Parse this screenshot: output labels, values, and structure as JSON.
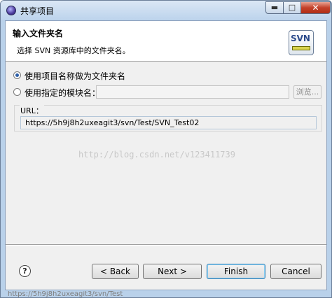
{
  "window": {
    "title": "共享项目",
    "controls": {
      "minimize": "▬",
      "maximize": "□",
      "close": "✕"
    }
  },
  "header": {
    "title": "输入文件夹名",
    "description": "选择 SVN 资源库中的文件夹名。",
    "logo_text": "SVN"
  },
  "options": {
    "use_project_name_label": "使用项目名称做为文件夹名",
    "use_project_name_checked": true,
    "use_specified_module_label": "使用指定的模块名：",
    "use_specified_module_checked": false,
    "module_name_value": "",
    "browse_label": "浏览..."
  },
  "url": {
    "label": "URL：",
    "value": "https://5h9j8h2uxeagit3/svn/Test/SVN_Test02"
  },
  "watermark": "http://blog.csdn.net/v123411739",
  "buttons": {
    "help_label": "?",
    "back_label": "< Back",
    "next_label": "Next >",
    "finish_label": "Finish",
    "cancel_label": "Cancel"
  },
  "bottom_strip_text": "https://5h9j8h2uxeagit3/svn/Test"
}
